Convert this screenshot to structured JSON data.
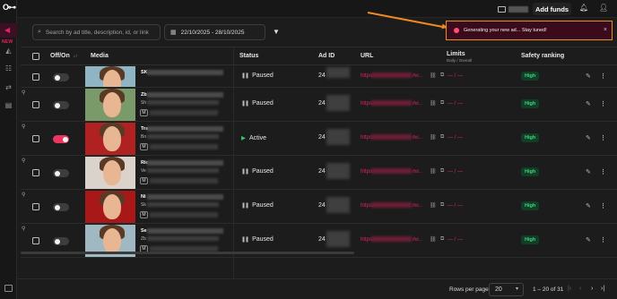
{
  "rail": {
    "logo": "O⊶",
    "new_badge": "NEW"
  },
  "topbar": {
    "add_funds_label": "Add funds"
  },
  "filters": {
    "search_placeholder": "Search by ad title, description, id, or link",
    "date_range": "22/10/2025 - 28/10/2025"
  },
  "toast": {
    "message": "Generating your new ad... Stay tuned!"
  },
  "table": {
    "headers": {
      "onoff": "Off/On",
      "sort_icon": "↓↑",
      "media": "Media",
      "status": "Status",
      "adid": "Ad ID",
      "url": "URL",
      "limits": "Limits",
      "limits_sub": "Daily / Overall",
      "safety": "Safety ranking"
    },
    "rows": [
      {
        "on": false,
        "title": "SK",
        "sub": "",
        "badge": "",
        "status": "Paused",
        "adid": "24",
        "url_prefix": "https:",
        "url_tail": "/fol...",
        "limits": "— / —",
        "rank": "High",
        "thumb_bg": "#8fb5c4"
      },
      {
        "on": false,
        "title": "Zb",
        "sub": "Sh",
        "badge": "M",
        "status": "Paused",
        "adid": "24",
        "url_prefix": "https:",
        "url_tail": "/fol...",
        "limits": "— / —",
        "rank": "High",
        "thumb_bg": "#7a9a6a"
      },
      {
        "on": true,
        "title": "Tra",
        "sub": "Bo",
        "badge": "M",
        "status": "Active",
        "adid": "24",
        "url_prefix": "https:",
        "url_tail": "/fol...",
        "limits": "— / —",
        "rank": "High",
        "thumb_bg": "#b02222"
      },
      {
        "on": false,
        "title": "Ric",
        "sub": "Ve",
        "badge": "M",
        "status": "Paused",
        "adid": "24",
        "url_prefix": "https:",
        "url_tail": "/fol...",
        "limits": "— / —",
        "rank": "High",
        "thumb_bg": "#d9d3cc"
      },
      {
        "on": false,
        "title": "Ni",
        "sub": "Sk",
        "badge": "M",
        "status": "Paused",
        "adid": "24",
        "url_prefix": "https:",
        "url_tail": "/fol...",
        "limits": "— / —",
        "rank": "High",
        "thumb_bg": "#a81818"
      },
      {
        "on": false,
        "title": "Se",
        "sub": "Zb",
        "badge": "M",
        "status": "Paused",
        "adid": "24",
        "url_prefix": "https:",
        "url_tail": "/fol...",
        "limits": "— / —",
        "rank": "High",
        "thumb_bg": "#9fb8c2"
      }
    ]
  },
  "footer": {
    "rows_per_page_label": "Rows per page:",
    "rows_per_page_value": "20",
    "range": "1 – 20 of 31"
  },
  "colors": {
    "accent": "#e0245e",
    "toast_border": "#f08a24",
    "rank_bg": "#123d27",
    "rank_text": "#3fd67c"
  }
}
